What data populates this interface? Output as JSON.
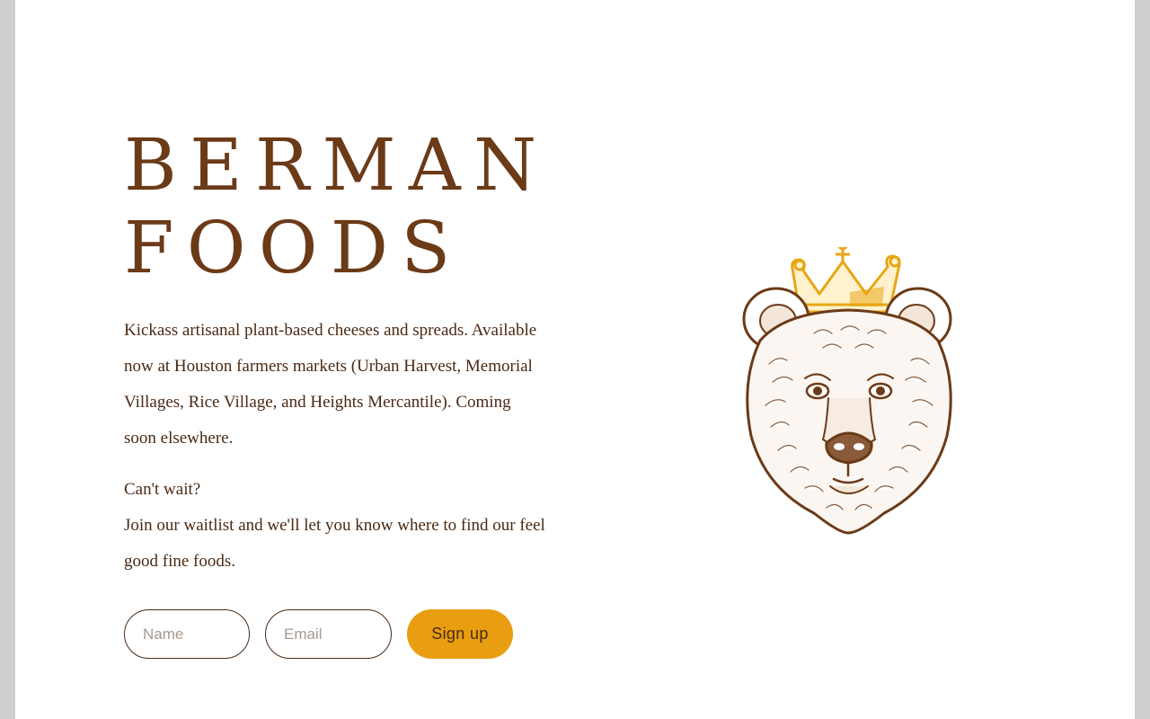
{
  "hero": {
    "title_line1": "BERMAN",
    "title_line2": "FOODS",
    "intro": "Kickass artisanal plant-based cheeses and spreads. Available now at Houston farmers markets (Urban Harvest, Memorial Villages, Rice Village, and Heights Mercantile). Coming soon elsewhere.",
    "question": "Can't wait?",
    "waitlist_text": "Join our waitlist and we'll let you know where to find our feel good fine foods."
  },
  "form": {
    "name_placeholder": "Name",
    "email_placeholder": "Email",
    "signup_label": "Sign up"
  },
  "illustration": {
    "icon": "crowned-bear-icon"
  },
  "colors": {
    "brand_brown": "#6b3a17",
    "text_brown": "#4a2a14",
    "button_gold": "#e89e10",
    "crown_gold": "#e8a615",
    "side_gray": "#cfcfcf"
  }
}
